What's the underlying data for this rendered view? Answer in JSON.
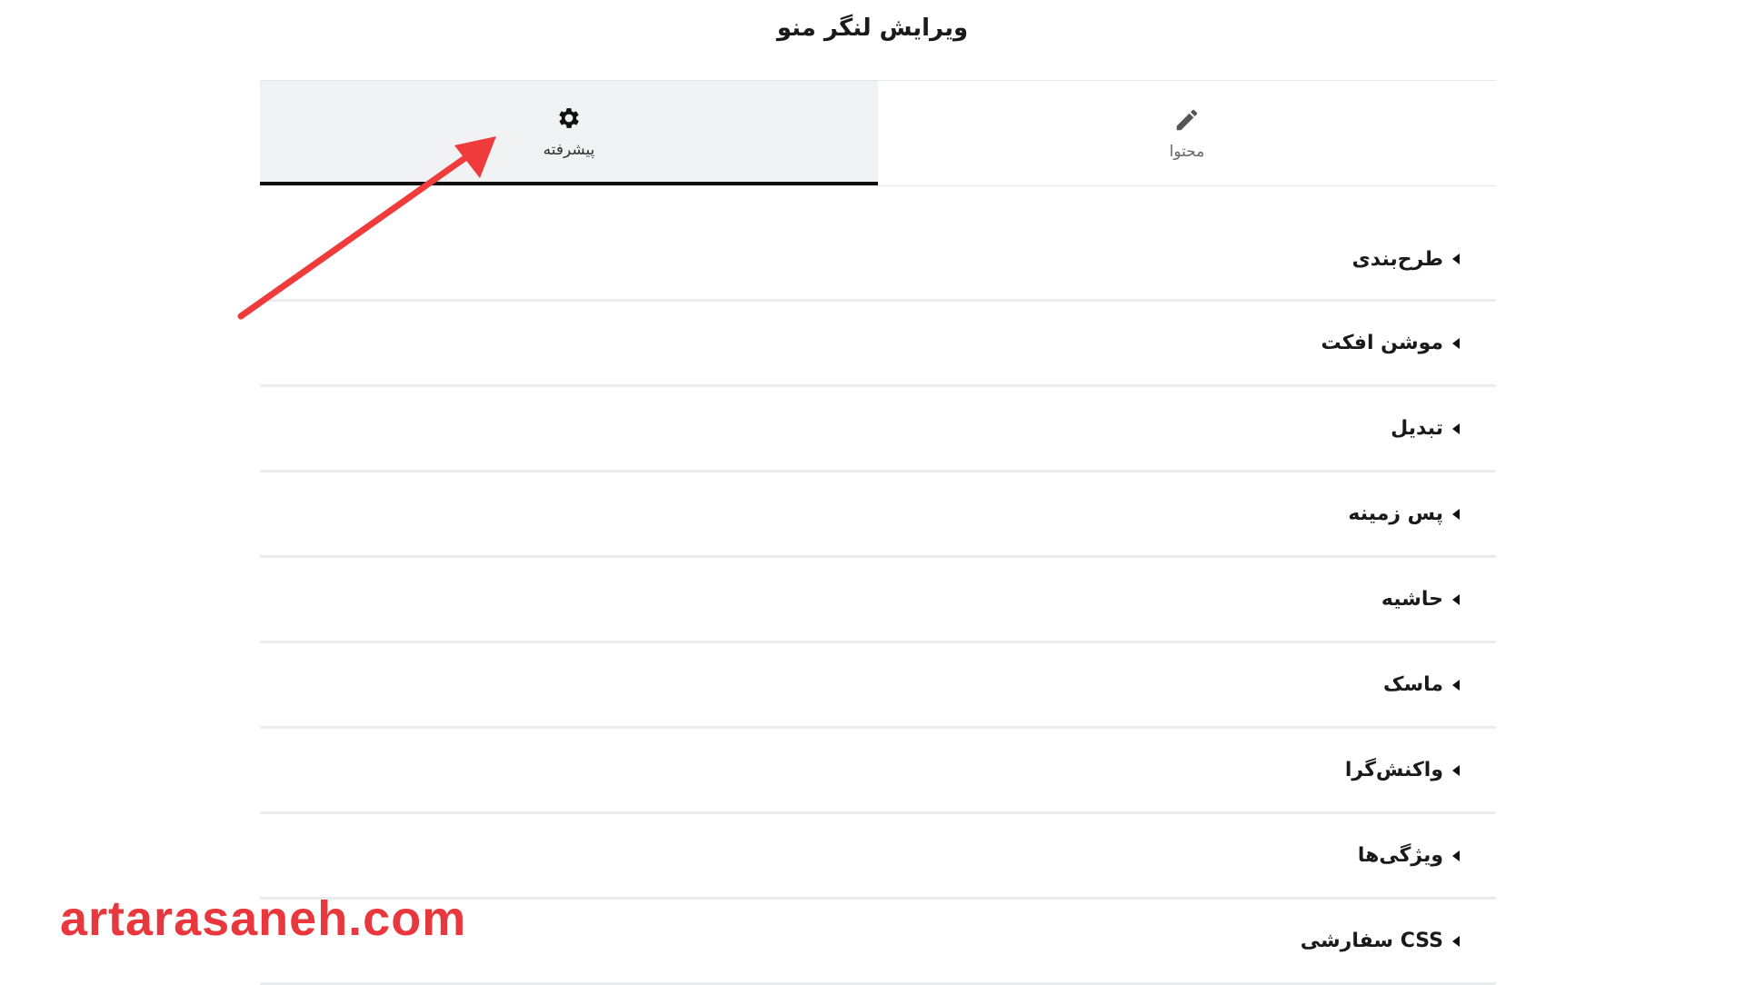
{
  "header": {
    "title": "ویرایش لنگر منو"
  },
  "tabs": [
    {
      "label": "پیشرفته",
      "icon": "gear-icon",
      "active": true
    },
    {
      "label": "محتوا",
      "icon": "pencil-icon",
      "active": false
    }
  ],
  "sections": [
    {
      "label": "طرح‌بندی"
    },
    {
      "label": "موشن افکت"
    },
    {
      "label": "تبدیل"
    },
    {
      "label": "پس زمینه"
    },
    {
      "label": "حاشیه"
    },
    {
      "label": "ماسک"
    },
    {
      "label": "واکنش‌گرا"
    },
    {
      "label": "ویژگی‌ها"
    },
    {
      "label": "CSS سفارشی"
    }
  ],
  "watermark": {
    "text": "artarasaneh.com",
    "color": "#e8383d"
  },
  "annotation": {
    "color": "#ef3b3b",
    "icon": "red-arrow"
  },
  "colors": {
    "active_tab_bg": "#f1f2f3",
    "active_tab_border": "#111111"
  }
}
